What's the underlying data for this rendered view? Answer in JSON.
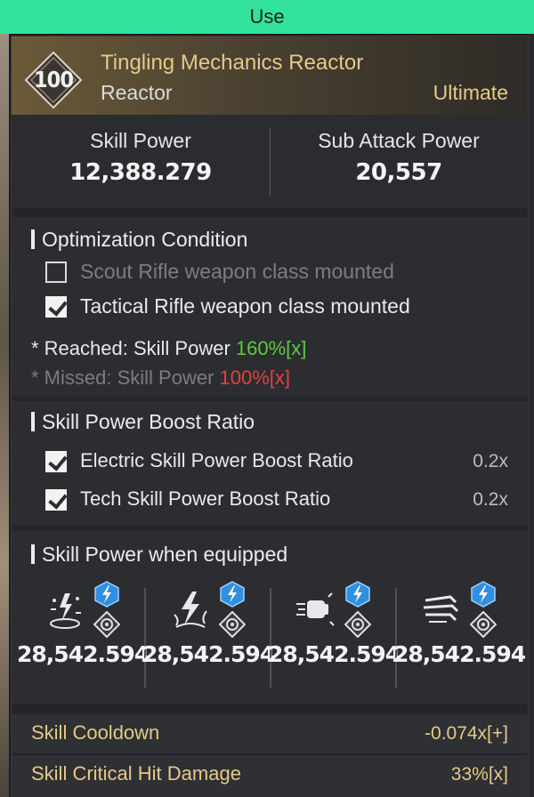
{
  "top_bar": {
    "label": "Use"
  },
  "module": {
    "level": "100",
    "name": "Tingling Mechanics Reactor",
    "type": "Reactor",
    "tier": "Ultimate"
  },
  "stats": {
    "skill_power_label": "Skill Power",
    "skill_power_value": "12,388.279",
    "sub_attack_label": "Sub Attack Power",
    "sub_attack_value": "20,557"
  },
  "optimization": {
    "title": "Optimization Condition",
    "conditions": [
      {
        "label": "Scout Rifle weapon class mounted",
        "checked": false
      },
      {
        "label": "Tactical Rifle weapon class mounted",
        "checked": true
      }
    ],
    "reached_prefix": "* Reached: Skill Power ",
    "reached_value": "160%[x]",
    "missed_prefix": "* Missed: Skill Power ",
    "missed_value": "100%[x]"
  },
  "boost_ratio": {
    "title": "Skill Power Boost Ratio",
    "items": [
      {
        "label": "Electric Skill Power Boost Ratio",
        "value": "0.2x",
        "checked": true
      },
      {
        "label": "Tech Skill Power Boost Ratio",
        "value": "0.2x",
        "checked": true
      }
    ]
  },
  "equipped": {
    "title": "Skill Power when equipped",
    "skills": [
      {
        "icon": "electric-burst-skill-icon",
        "element": "electric-icon",
        "archetype": "tech-icon",
        "value": "28,542.594"
      },
      {
        "icon": "thunder-strike-skill-icon",
        "element": "electric-icon",
        "archetype": "tech-icon",
        "value": "28,542.594"
      },
      {
        "icon": "fist-skill-icon",
        "element": "electric-icon",
        "archetype": "tech-icon",
        "value": "28,542.594"
      },
      {
        "icon": "claw-skill-icon",
        "element": "electric-icon",
        "archetype": "tech-icon",
        "value": "28,542.594"
      }
    ]
  },
  "bottom_stats": [
    {
      "label": "Skill Cooldown",
      "value": "-0.074x[+]"
    },
    {
      "label": "Skill Critical Hit Damage",
      "value": "33%[x]"
    }
  ],
  "colors": {
    "accent_gold": "#e5c988",
    "use_bar": "#33e39d",
    "reached_green": "#5ccb3d",
    "missed_red": "#e2403f",
    "element_blue": "#2f8fe0"
  }
}
